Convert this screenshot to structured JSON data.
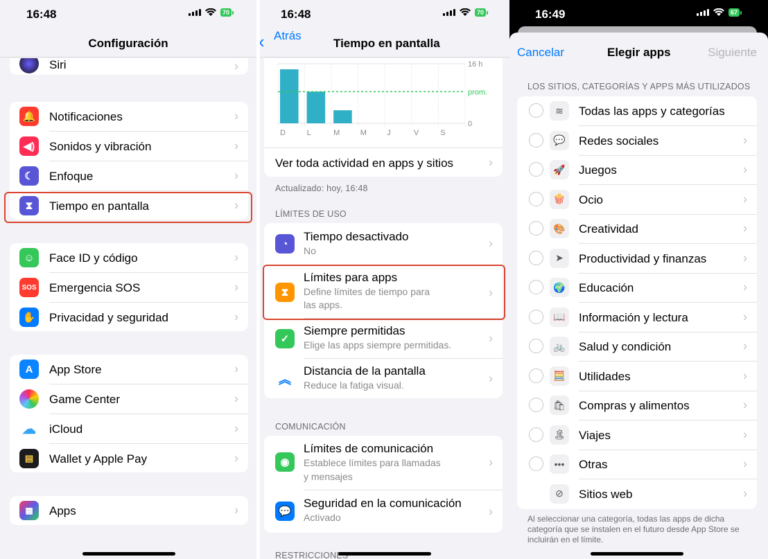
{
  "panel1": {
    "status_time": "16:48",
    "battery": "70",
    "title": "Configuración",
    "items_top": [
      {
        "label": "Siri",
        "icon": "siri-icon"
      }
    ],
    "group1": [
      {
        "label": "Notificaciones",
        "icon": "bell-icon",
        "color": "#ff3b30"
      },
      {
        "label": "Sonidos y vibración",
        "icon": "speaker-icon",
        "color": "#ff2d55"
      },
      {
        "label": "Enfoque",
        "icon": "moon-icon",
        "color": "#5856d6"
      },
      {
        "label": "Tiempo en pantalla",
        "icon": "hourglass-icon",
        "color": "#5856d6"
      }
    ],
    "group2": [
      {
        "label": "Face ID y código",
        "icon": "faceid-icon",
        "color": "#34c759"
      },
      {
        "label": "Emergencia SOS",
        "icon": "sos-icon",
        "color": "#ff3b30",
        "glyph": "SOS"
      },
      {
        "label": "Privacidad y seguridad",
        "icon": "hand-icon",
        "color": "#007aff"
      }
    ],
    "group3": [
      {
        "label": "App Store",
        "icon": "appstore-icon",
        "color": "#0a84ff"
      },
      {
        "label": "Game Center",
        "icon": "gamecenter-icon",
        "color": "#ffffff"
      },
      {
        "label": "iCloud",
        "icon": "icloud-icon",
        "color": "#ffffff"
      },
      {
        "label": "Wallet y Apple Pay",
        "icon": "wallet-icon",
        "color": "#1c1c1e"
      }
    ],
    "group4": [
      {
        "label": "Apps",
        "icon": "apps-grid-icon",
        "color": "#5e5ce6"
      }
    ]
  },
  "panel2": {
    "status_time": "16:48",
    "battery": "70",
    "back_label": "Atrás",
    "title": "Tiempo en pantalla",
    "chart": {
      "days": [
        "D",
        "L",
        "M",
        "M",
        "J",
        "V",
        "S"
      ],
      "top_label": "16 h",
      "avg_label": "prom.",
      "zero_label": "0"
    },
    "chart_data": {
      "type": "bar",
      "categories": [
        "D",
        "L",
        "M",
        "M",
        "J",
        "V",
        "S"
      ],
      "values": [
        14.5,
        8.5,
        3.5,
        0,
        0,
        0,
        0
      ],
      "ylim": [
        0,
        16
      ],
      "average": 8.5
    },
    "view_all": "Ver toda actividad en apps y sitios",
    "updated": "Actualizado: hoy, 16:48",
    "section_limits": "LÍMITES DE USO",
    "limits": [
      {
        "label": "Tiempo desactivado",
        "sub": "No",
        "icon": "downtime-icon",
        "color": "#5856d6"
      },
      {
        "label": "Límites para apps",
        "sub": "Define límites de tiempo para",
        "sub2": "las apps.",
        "icon": "hourglass-icon",
        "color": "#ff9500"
      },
      {
        "label": "Siempre permitidas",
        "sub": "Elige las apps siempre permitidas.",
        "icon": "checkmark-badge-icon",
        "color": "#34c759"
      },
      {
        "label": "Distancia de la pantalla",
        "sub": "Reduce la fatiga visual.",
        "icon": "distance-icon",
        "color": "#ffffff"
      }
    ],
    "section_comm": "COMUNICACIÓN",
    "comm": [
      {
        "label": "Límites de comunicación",
        "sub": "Establece límites para llamadas",
        "sub2": "y mensajes",
        "icon": "contact-icon",
        "color": "#34c759"
      },
      {
        "label": "Seguridad en la comunicación",
        "sub": "Activado",
        "icon": "chat-shield-icon",
        "color": "#007aff"
      }
    ],
    "section_restr": "RESTRICCIONES"
  },
  "panel3": {
    "status_time": "16:49",
    "battery": "67",
    "cancel": "Cancelar",
    "title": "Elegir apps",
    "next": "Siguiente",
    "section": "LOS SITIOS, CATEGORÍAS Y APPS MÁS UTILIZADOS",
    "categories": [
      {
        "label": "Todas las apps y categorías",
        "icon": "stack-icon",
        "glyph": "≋",
        "chev": false
      },
      {
        "label": "Redes sociales",
        "icon": "social-icon",
        "glyph": "💬",
        "chev": true
      },
      {
        "label": "Juegos",
        "icon": "rocket-icon",
        "glyph": "🚀",
        "chev": true
      },
      {
        "label": "Ocio",
        "icon": "popcorn-icon",
        "glyph": "🍿",
        "chev": true
      },
      {
        "label": "Creatividad",
        "icon": "palette-icon",
        "glyph": "🎨",
        "chev": true
      },
      {
        "label": "Productividad y finanzas",
        "icon": "paperplane-icon",
        "glyph": "➤",
        "chev": true
      },
      {
        "label": "Educación",
        "icon": "globe-icon",
        "glyph": "🌍",
        "chev": true
      },
      {
        "label": "Información y lectura",
        "icon": "book-icon",
        "glyph": "📖",
        "chev": true
      },
      {
        "label": "Salud y condición",
        "icon": "bicycle-icon",
        "glyph": "🚲",
        "chev": true
      },
      {
        "label": "Utilidades",
        "icon": "calculator-icon",
        "glyph": "🧮",
        "chev": true
      },
      {
        "label": "Compras y alimentos",
        "icon": "shopping-bag-icon",
        "glyph": "🛍",
        "chev": true
      },
      {
        "label": "Viajes",
        "icon": "island-icon",
        "glyph": "🏝",
        "chev": true
      },
      {
        "label": "Otras",
        "icon": "ellipsis-icon",
        "glyph": "•••",
        "chev": true
      },
      {
        "label": "Sitios web",
        "icon": "compass-icon",
        "glyph": "⊘",
        "chev": true
      }
    ],
    "footer": "Al seleccionar una categoría, todas las apps de dicha categoría que se instalen en el futuro desde App Store se incluirán en el límite."
  }
}
